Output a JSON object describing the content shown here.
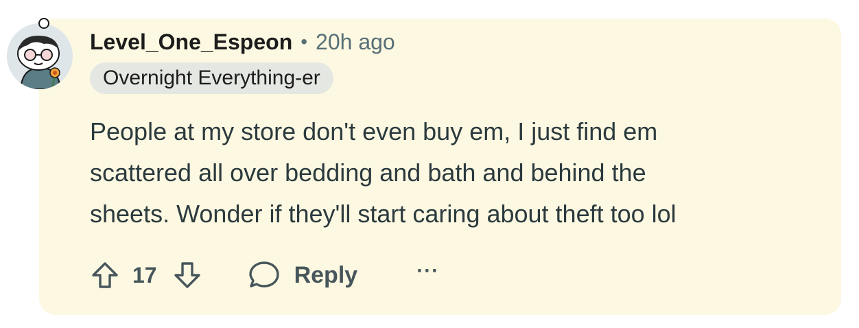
{
  "comment": {
    "username": "Level_One_Espeon",
    "separator": "•",
    "timestamp": "20h ago",
    "flair": "Overnight Everything-er",
    "body_lines": [
      "People at my store don't even buy em, I just find em",
      "scattered all over bedding and bath and behind the",
      "sheets. Wonder if they'll start caring about theft too lol"
    ],
    "score": "17",
    "reply_label": "Reply",
    "more_label": "···"
  },
  "colors": {
    "card_background": "#fdf8e1",
    "flair_background": "#e5e7e3",
    "meta_text": "#576f76",
    "action_text": "#46565b"
  },
  "icons": {
    "upvote": "arrow-up-outline-icon",
    "downvote": "arrow-down-outline-icon",
    "reply": "speech-bubble-icon",
    "more": "ellipsis-icon"
  }
}
